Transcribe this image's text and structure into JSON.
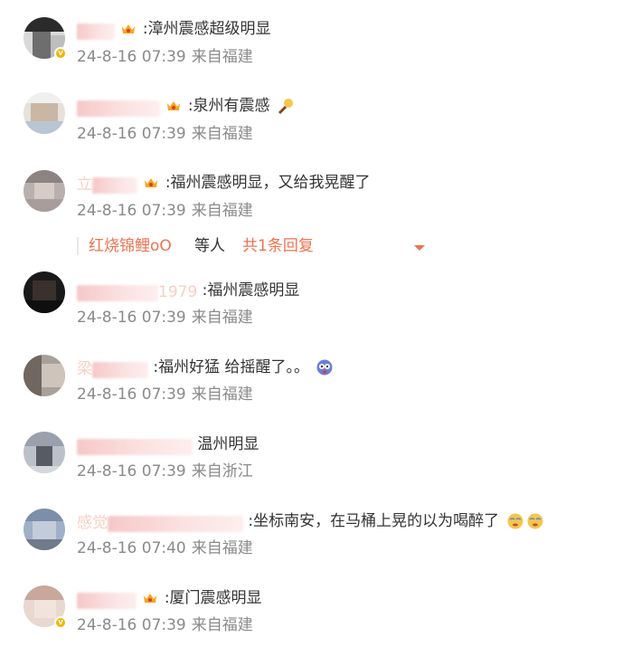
{
  "comments": [
    {
      "username_blurred": "漳州用户",
      "text": ":漳州震感超级明显",
      "time": "24-8-16 07:39",
      "source": "来自福建"
    },
    {
      "username_blurred": "泉州网友",
      "text": ":泉州有震感",
      "time": "24-8-16 07:39",
      "source": "来自福建"
    },
    {
      "username_blurred": "立",
      "text": ":福州震感明显，又给我晃醒了",
      "time": "24-8-16 07:39",
      "source": "来自福建",
      "replies": {
        "who": "红烧锦鲤oO",
        "mid": "等人",
        "count": "共1条回复"
      }
    },
    {
      "username_blurred": "1979",
      "text": ":福州震感明显",
      "time": "24-8-16 07:39",
      "source": "来自福建"
    },
    {
      "username_blurred": "梁",
      "text": ":福州好猛 给摇醒了。。",
      "time": "24-8-16 07:39",
      "source": "来自福建"
    },
    {
      "username_blurred": "",
      "text": "温州明显",
      "time": "24-8-16 07:39",
      "source": "来自浙江"
    },
    {
      "username_blurred": "感觉",
      "text": ":坐标南安，在马桶上晃的以为喝醉了",
      "time": "24-8-16 07:40",
      "source": "来自福建"
    },
    {
      "username_blurred": "",
      "text": ":厦门震感明显",
      "time": "24-8-16 07:39",
      "source": "来自福建"
    }
  ],
  "colors": {
    "link_orange": "#eb7350",
    "text_dark": "#333333",
    "meta_gray": "#8a8a8a",
    "vip_gold": "#f5b400"
  },
  "icons": [
    "crown-badge-icon",
    "chevron-down-icon",
    "verified-badge-icon",
    "dizzy-emoji-icon",
    "drunk-emoji-icon",
    "thinking-emoji-icon"
  ]
}
